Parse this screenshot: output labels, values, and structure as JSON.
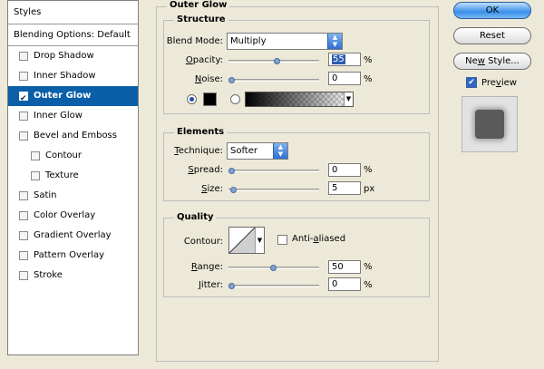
{
  "styles_list": {
    "header": "Styles",
    "blending_options": "Blending Options: Default",
    "effects": [
      {
        "label": "Drop Shadow",
        "checked": false
      },
      {
        "label": "Inner Shadow",
        "checked": false
      },
      {
        "label": "Outer Glow",
        "checked": true,
        "selected": true
      },
      {
        "label": "Inner Glow",
        "checked": false
      },
      {
        "label": "Bevel and Emboss",
        "checked": false
      },
      {
        "label": "Contour",
        "checked": false,
        "sub": true
      },
      {
        "label": "Texture",
        "checked": false,
        "sub": true
      },
      {
        "label": "Satin",
        "checked": false
      },
      {
        "label": "Color Overlay",
        "checked": false
      },
      {
        "label": "Gradient Overlay",
        "checked": false
      },
      {
        "label": "Pattern Overlay",
        "checked": false
      },
      {
        "label": "Stroke",
        "checked": false
      }
    ]
  },
  "panel": {
    "title": "Outer Glow",
    "structure": {
      "legend": "Structure",
      "blend_mode_label": "Blend Mode:",
      "blend_mode_value": "Multiply",
      "opacity_label_u": "O",
      "opacity_label_rest": "pacity:",
      "opacity_value": "55",
      "opacity_unit": "%",
      "opacity_slider": 0.55,
      "noise_label_u": "N",
      "noise_label_rest": "oise:",
      "noise_value": "0",
      "noise_unit": "%",
      "noise_slider": 0
    },
    "elements": {
      "legend": "Elements",
      "technique_label_u": "T",
      "technique_label_rest": "echnique:",
      "technique_value": "Softer",
      "spread_label_u": "S",
      "spread_label_rest": "pread:",
      "spread_value": "0",
      "spread_unit": "%",
      "spread_slider": 0,
      "size_label_u": "S",
      "size_label_rest": "ize:",
      "size_value": "5",
      "size_unit": "px",
      "size_slider": 0.02
    },
    "quality": {
      "legend": "Quality",
      "contour_label": "Contour:",
      "anti_aliased_pre": "Anti-",
      "anti_aliased_u": "a",
      "anti_aliased_post": "liased",
      "anti_aliased_checked": false,
      "range_label_u": "R",
      "range_label_rest": "ange:",
      "range_value": "50",
      "range_unit": "%",
      "range_slider": 0.5,
      "jitter_label_u": "J",
      "jitter_label_rest": "itter:",
      "jitter_value": "0",
      "jitter_unit": "%",
      "jitter_slider": 0
    }
  },
  "buttons": {
    "ok": "OK",
    "reset": "Reset",
    "new_style_pre": "Ne",
    "new_style_u": "w",
    "new_style_post": " Style...",
    "preview_pre": "Pre",
    "preview_u": "v",
    "preview_post": "iew",
    "preview_checked": true
  },
  "colors": {
    "selection": "#0a5fa8",
    "glow_color": "#000000",
    "primary_button": "#3b8fe8"
  }
}
